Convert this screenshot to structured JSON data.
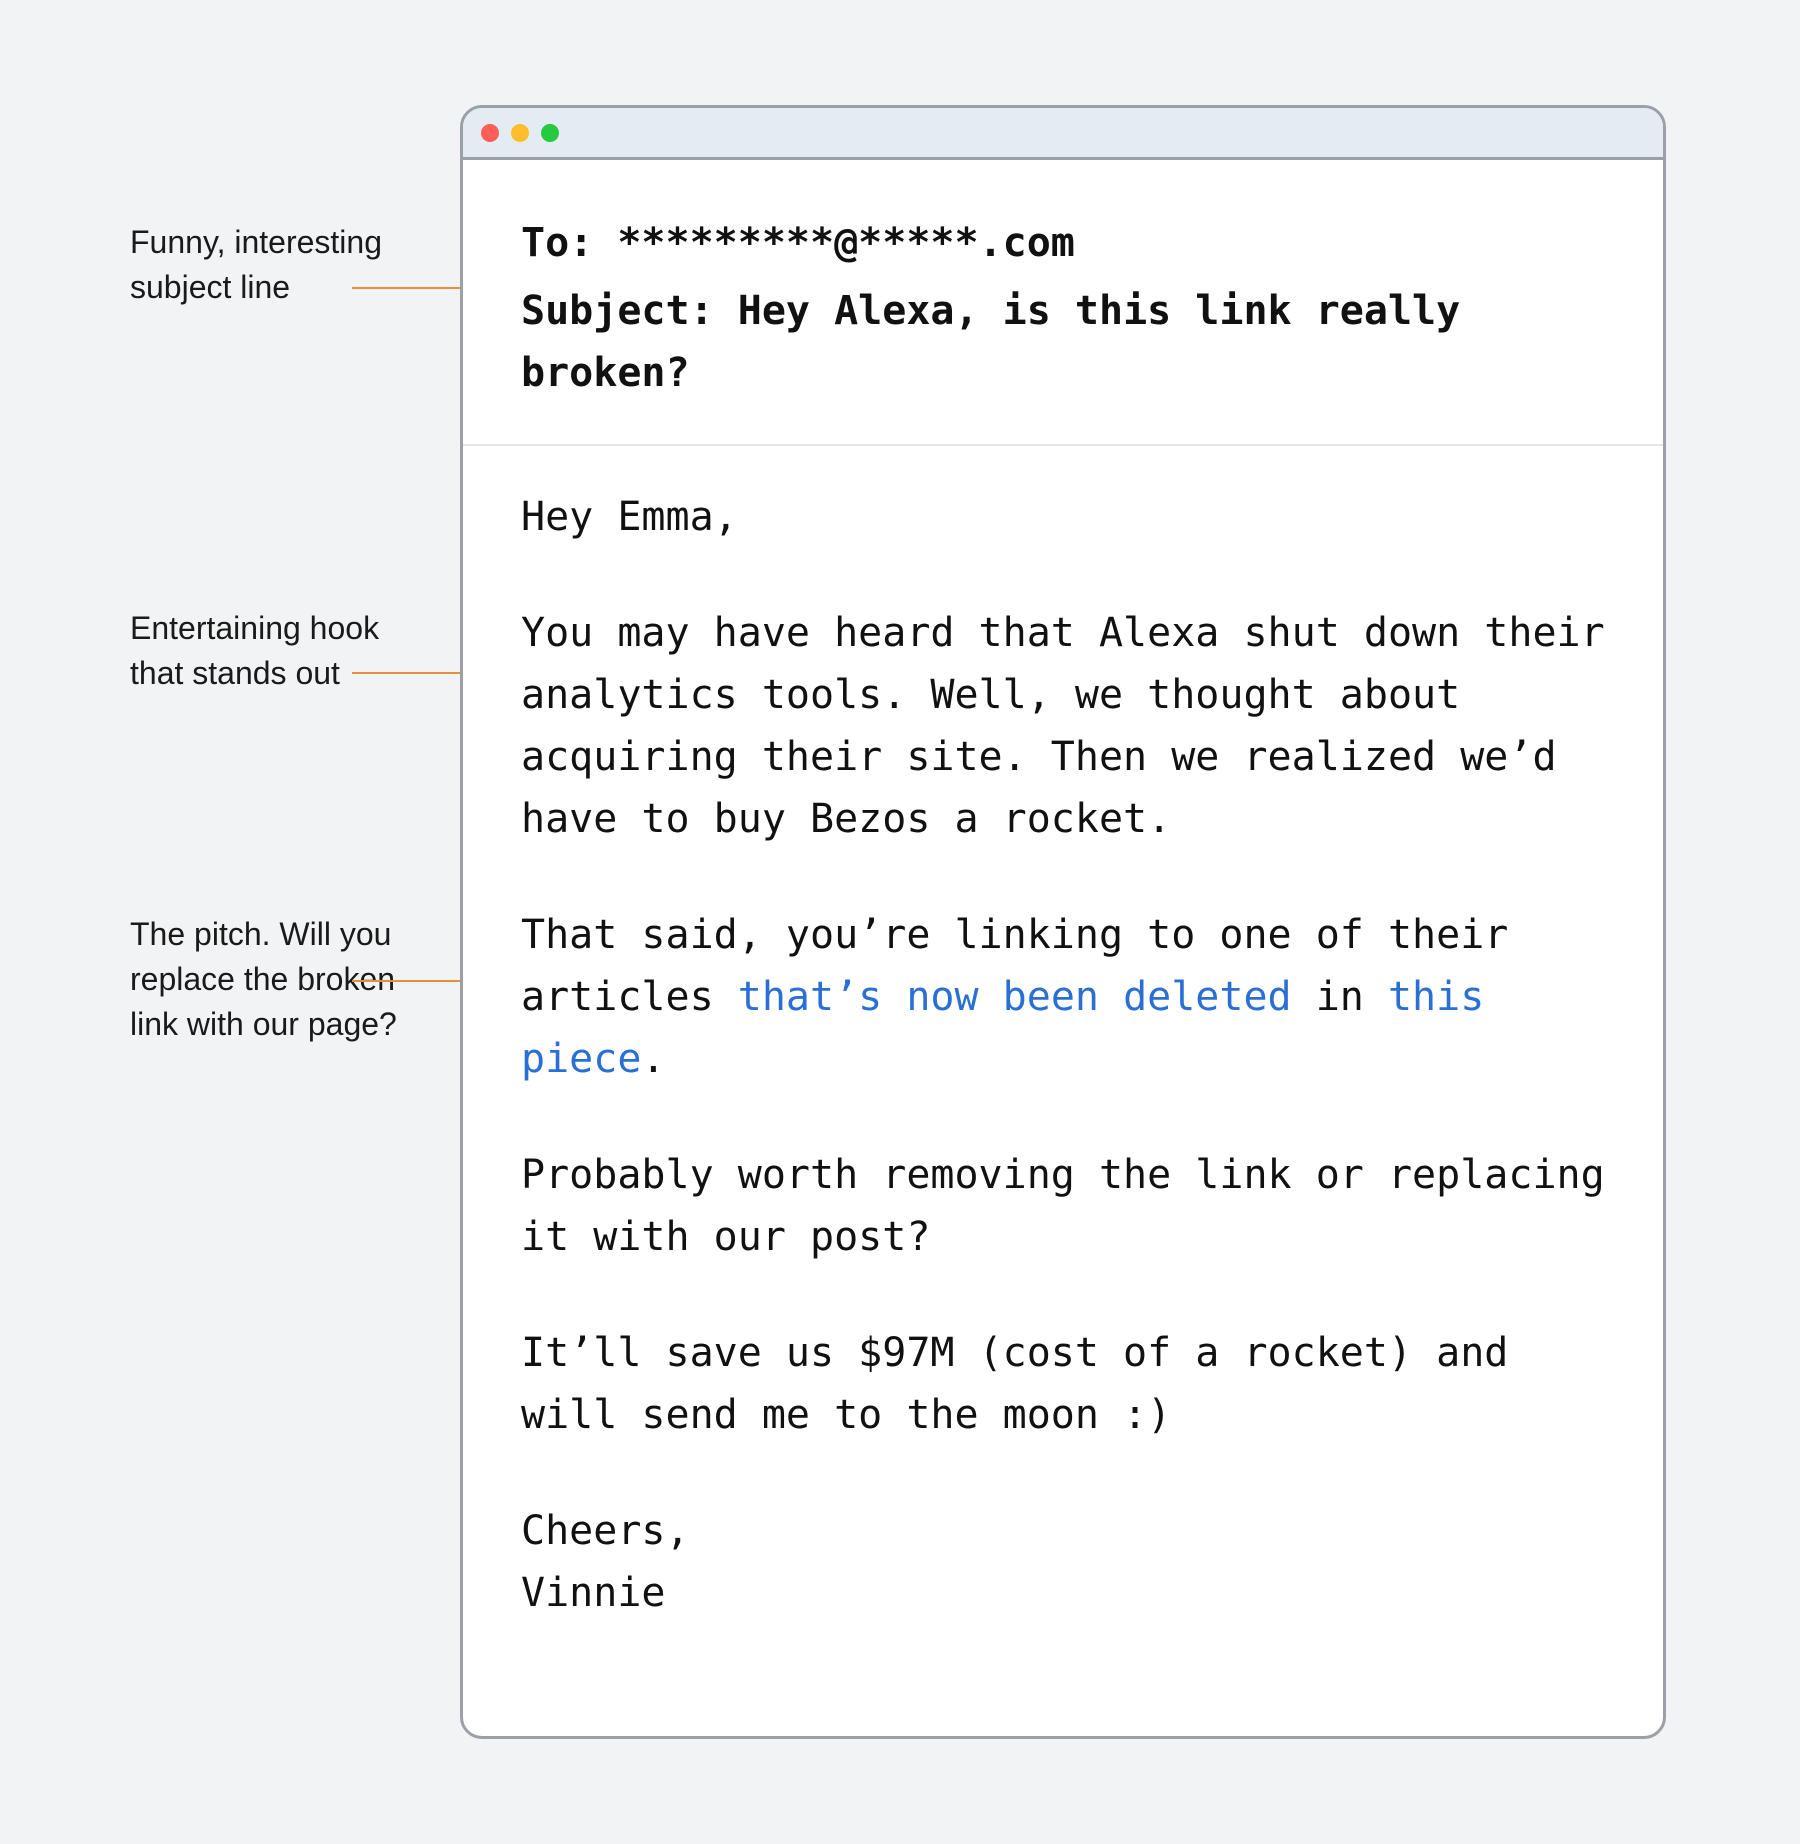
{
  "annotations": {
    "subject_line": "Funny, interesting subject line",
    "hook": "Entertaining hook that stands out",
    "pitch": "The pitch. Will you replace the broken link with our page?"
  },
  "email": {
    "to_label": "To: ",
    "to_value": "*********@*****.com",
    "subject_label": "Subject: ",
    "subject_value": "Hey Alexa, is this link really broken?",
    "greeting": "Hey Emma,",
    "hook_para": "You may have heard that Alexa shut down their analytics tools. Well, we thought about acquiring their site. Then we realized we’d have to buy Bezos a rocket.",
    "pitch_pre": "That said, you’re linking to one of their articles ",
    "pitch_link1": "that’s now been deleted",
    "pitch_mid": " in ",
    "pitch_link2": "this piece",
    "pitch_post": ".",
    "ask": "Probably worth removing the link or replacing it with our post?",
    "joke": "It’ll save us $97M (cost of a rocket) and will send me to the moon :)",
    "signoff": "Cheers,",
    "name": "Vinnie"
  },
  "colors": {
    "accent": "#e69138",
    "link": "#2a6fd6"
  }
}
